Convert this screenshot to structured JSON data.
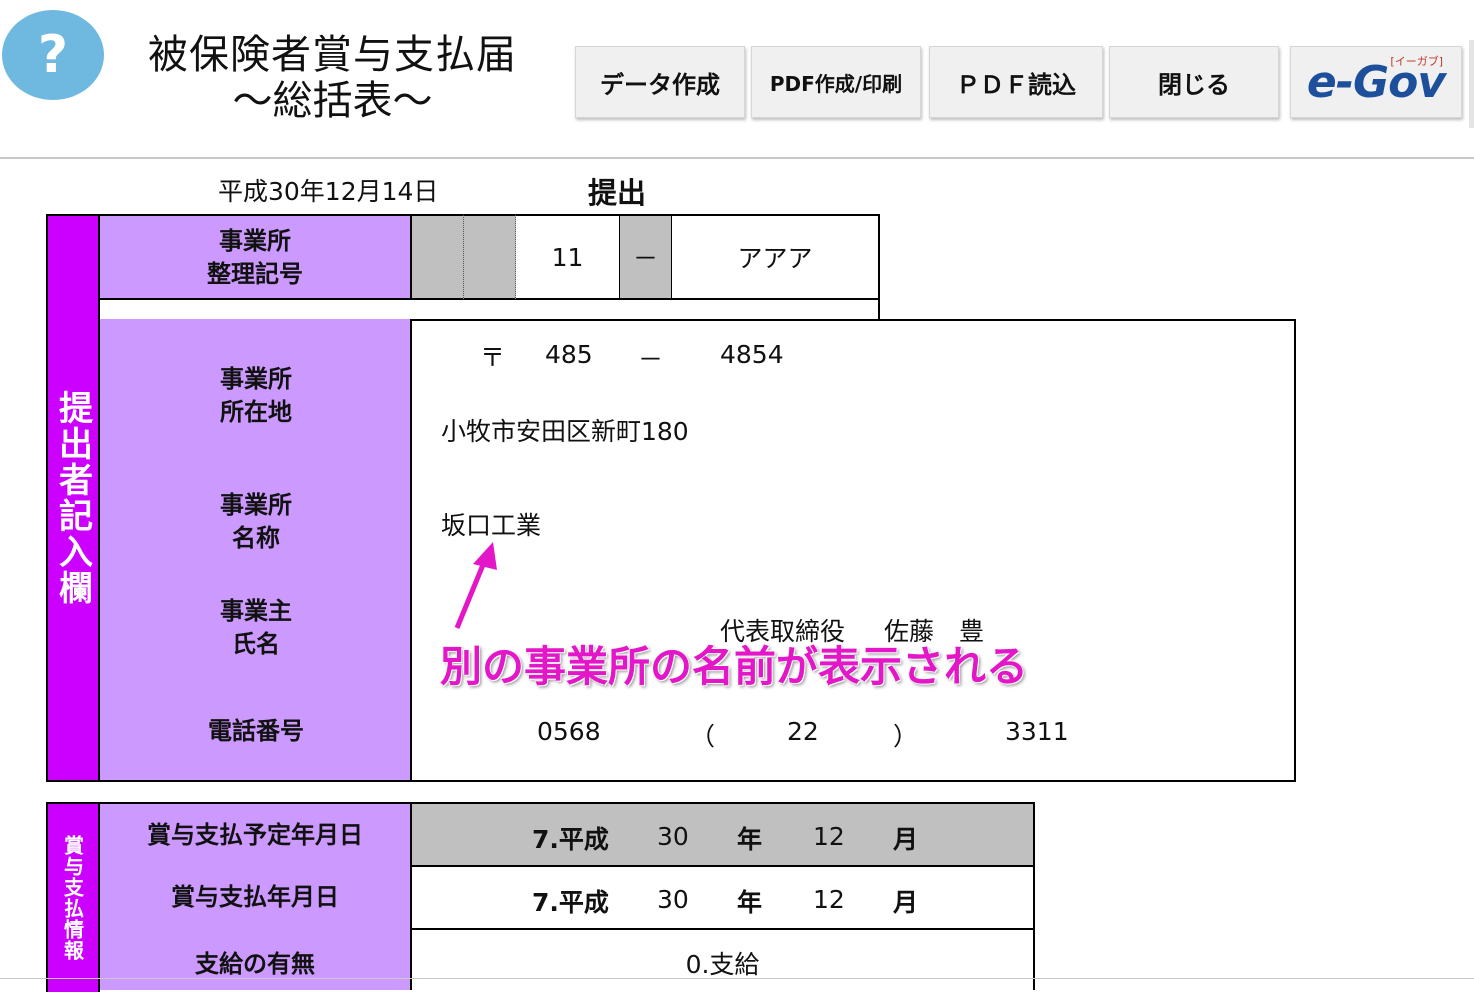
{
  "header": {
    "help_icon": "?",
    "title_line1": "被保険者賞与支払届",
    "title_line2": "～総括表～",
    "buttons": {
      "create_data": "データ作成",
      "pdf_print": "PDF作成/印刷",
      "pdf_load": "ＰＤＦ読込",
      "close": "閉じる"
    },
    "egov_logo_text": "e-Gov",
    "egov_logo_sub": "[イーガブ]"
  },
  "submission": {
    "date": "平成30年12月14日",
    "label": "提出"
  },
  "submitter": {
    "section_label": "提出者記入欄",
    "office_code_label": "事業所\n整理記号",
    "office_code_number": "11",
    "office_code_dash": "－",
    "office_code_symbol": "アアア",
    "address_label": "事業所\n所在地",
    "postal_mark": "〒",
    "postal_first": "485",
    "postal_dash": "－",
    "postal_second": "4854",
    "address": "小牧市安田区新町180",
    "name_label": "事業所\n名称",
    "office_name": "坂口工業",
    "owner_label": "事業主\n氏名",
    "owner_title": "代表取締役",
    "owner_name": "佐藤　豊",
    "phone_label": "電話番号",
    "phone_area": "0568",
    "phone_open": "（",
    "phone_local": "22",
    "phone_close": "）",
    "phone_number": "3311"
  },
  "annotation": {
    "text": "別の事業所の名前が表示される",
    "color": "#e316c8"
  },
  "bonus": {
    "section_label": "賞与支払情報",
    "rows": [
      {
        "label": "賞与支払予定年月日",
        "era": "7.平成",
        "year": "30",
        "year_unit": "年",
        "month": "12",
        "month_unit": "月"
      },
      {
        "label": "賞与支払年月日",
        "era": "7.平成",
        "year": "30",
        "year_unit": "年",
        "month": "12",
        "month_unit": "月"
      },
      {
        "label": "支給の有無",
        "value": "0.支給"
      }
    ]
  },
  "colors": {
    "label_bg": "#cc99ff",
    "section_bg": "#cc00ff",
    "gray_cell": "#c0c0c0"
  }
}
